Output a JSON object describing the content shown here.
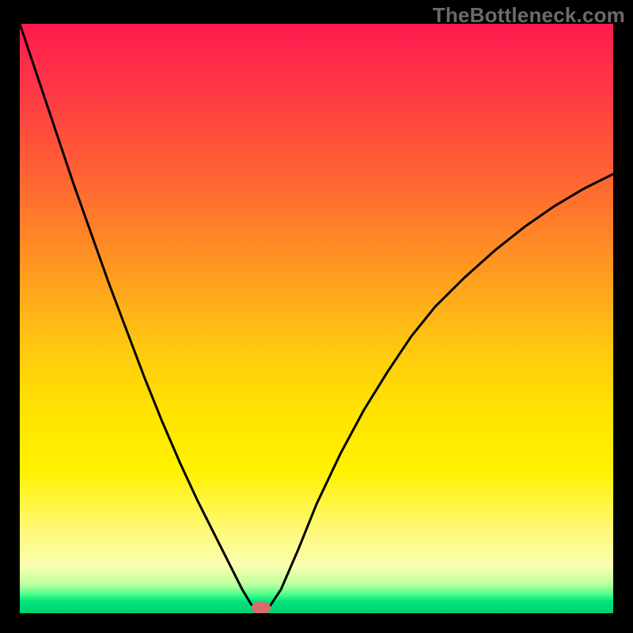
{
  "watermark": "TheBottleneck.com",
  "chart_data": {
    "type": "line",
    "title": "",
    "xlabel": "",
    "ylabel": "",
    "xlim": [
      0,
      100
    ],
    "ylim": [
      0,
      100
    ],
    "grid": false,
    "legend": false,
    "colors": {
      "curve": "#000000",
      "marker": "#d96b6b",
      "gradient_top": "#ff1a50",
      "gradient_mid": "#ffe400",
      "gradient_bottom": "#00d070"
    },
    "marker": {
      "x": 40.6,
      "y": 1.0
    },
    "series": [
      {
        "name": "curve",
        "x": [
          0.0,
          3.0,
          6.0,
          9.0,
          12.0,
          15.0,
          18.0,
          21.0,
          24.0,
          27.0,
          30.0,
          33.0,
          36.0,
          37.5,
          39.0,
          40.0,
          41.0,
          42.0,
          44.0,
          47.0,
          50.0,
          54.0,
          58.0,
          62.0,
          66.0,
          70.0,
          75.0,
          80.0,
          85.0,
          90.0,
          95.0,
          100.0
        ],
        "y": [
          100.0,
          91.0,
          82.0,
          73.0,
          64.5,
          56.0,
          48.0,
          40.0,
          32.5,
          25.5,
          19.0,
          13.0,
          7.0,
          4.0,
          1.5,
          0.6,
          0.6,
          1.0,
          4.0,
          11.0,
          18.5,
          27.0,
          34.5,
          41.0,
          47.0,
          52.0,
          57.0,
          61.5,
          65.5,
          69.0,
          72.0,
          74.5
        ]
      }
    ]
  }
}
